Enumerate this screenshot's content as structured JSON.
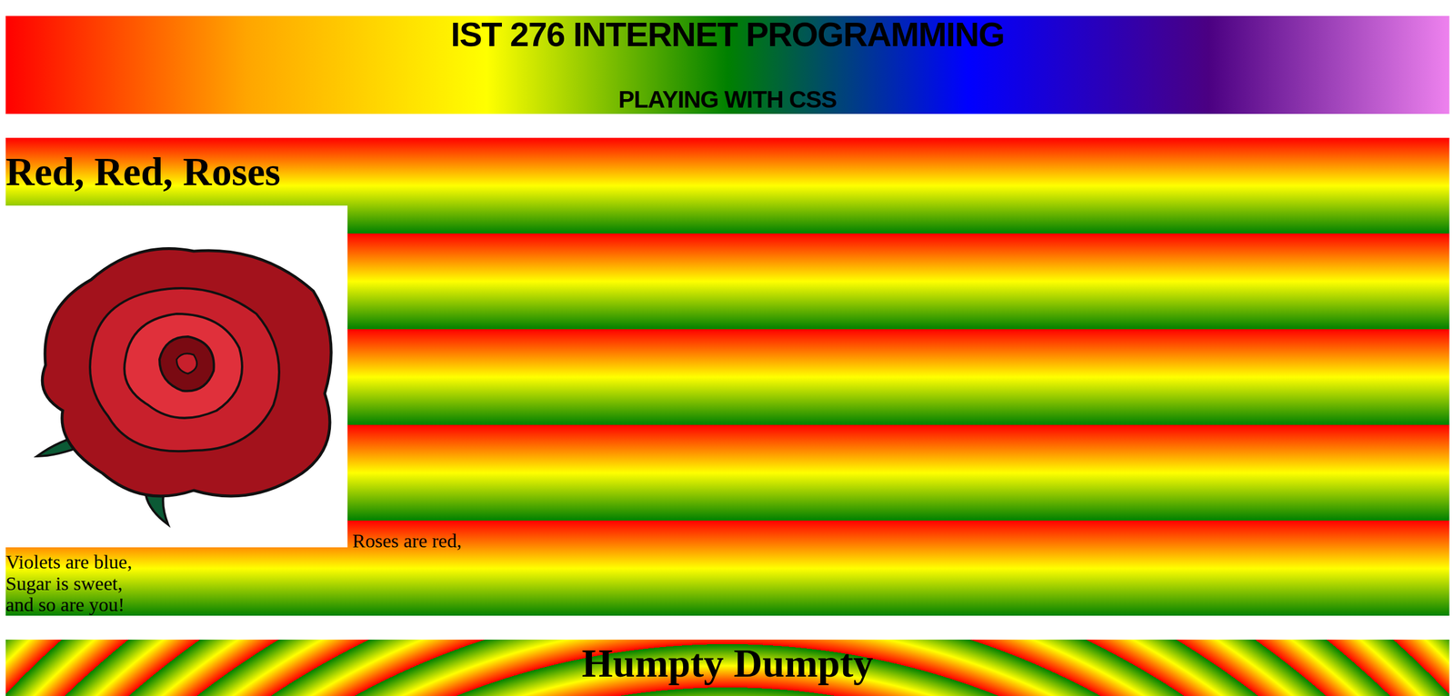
{
  "header": {
    "title": "IST 276 INTERNET PROGRAMMING",
    "subtitle": "PLAYING WITH CSS"
  },
  "roses": {
    "title": "Red, Red, Roses",
    "poem": [
      "Roses are red,",
      "Violets are blue,",
      "Sugar is sweet,",
      "and so are you!"
    ]
  },
  "humpty": {
    "title": "Humpty Dumpty"
  }
}
